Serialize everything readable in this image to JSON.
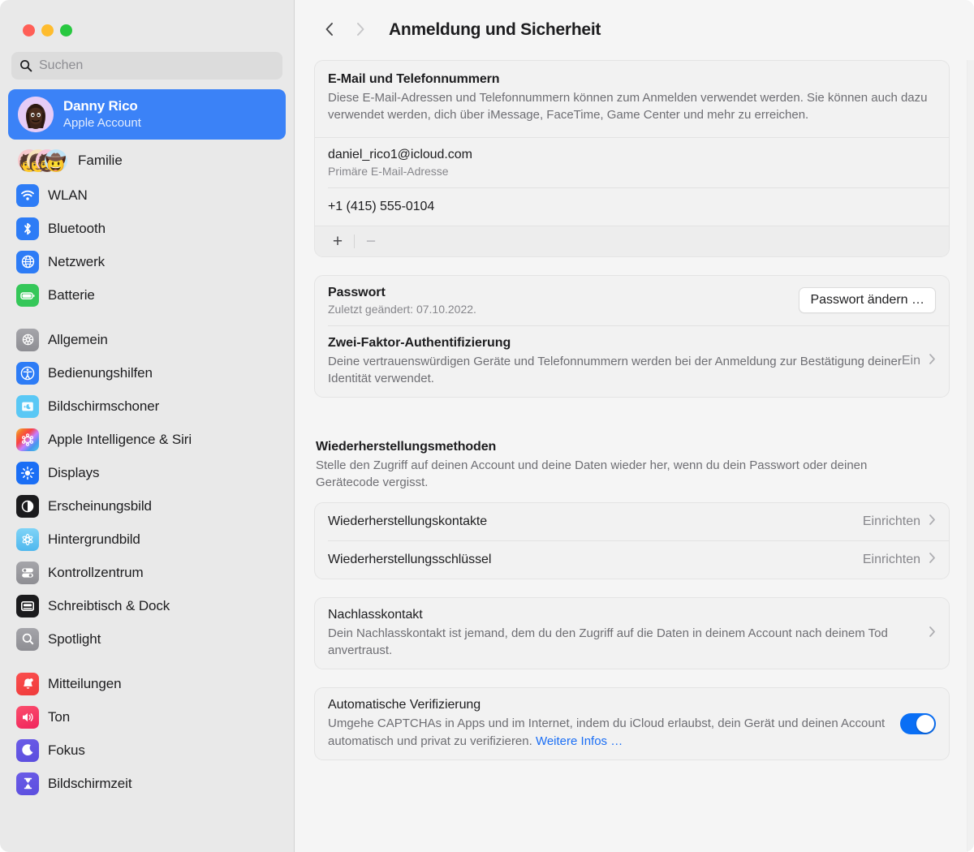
{
  "window": {
    "traffic_lights": [
      "close",
      "minimize",
      "zoom"
    ]
  },
  "sidebar": {
    "search": {
      "placeholder": "Suchen",
      "value": "",
      "icon": "search-icon"
    },
    "account": {
      "name": "Danny Rico",
      "subtitle": "Apple Account",
      "selected": true
    },
    "family": {
      "label": "Familie",
      "avatar_count": 4
    },
    "groups": [
      {
        "items": [
          {
            "label": "WLAN",
            "icon": "wifi-icon"
          },
          {
            "label": "Bluetooth",
            "icon": "bluetooth-icon"
          },
          {
            "label": "Netzwerk",
            "icon": "globe-icon"
          },
          {
            "label": "Batterie",
            "icon": "battery-icon"
          }
        ]
      },
      {
        "items": [
          {
            "label": "Allgemein",
            "icon": "gear-icon"
          },
          {
            "label": "Bedienungshilfen",
            "icon": "accessibility-icon"
          },
          {
            "label": "Bildschirmschoner",
            "icon": "screensaver-icon"
          },
          {
            "label": "Apple Intelligence & Siri",
            "icon": "apple-intelligence-icon"
          },
          {
            "label": "Displays",
            "icon": "display-brightness-icon"
          },
          {
            "label": "Erscheinungsbild",
            "icon": "appearance-icon"
          },
          {
            "label": "Hintergrundbild",
            "icon": "wallpaper-icon"
          },
          {
            "label": "Kontrollzentrum",
            "icon": "control-center-icon"
          },
          {
            "label": "Schreibtisch & Dock",
            "icon": "desktop-dock-icon"
          },
          {
            "label": "Spotlight",
            "icon": "spotlight-icon"
          }
        ]
      },
      {
        "items": [
          {
            "label": "Mitteilungen",
            "icon": "notifications-bell-icon"
          },
          {
            "label": "Ton",
            "icon": "sound-speaker-icon"
          },
          {
            "label": "Fokus",
            "icon": "focus-moon-icon"
          },
          {
            "label": "Bildschirmzeit",
            "icon": "screen-time-hourglass-icon"
          }
        ]
      }
    ]
  },
  "toolbar": {
    "back_icon": "chevron-left-icon",
    "forward_icon": "chevron-right-icon",
    "back_enabled": true,
    "forward_enabled": false,
    "title": "Anmeldung und Sicherheit"
  },
  "main": {
    "email_section": {
      "title": "E-Mail und Telefonnummern",
      "description": "Diese E-Mail-Adressen und Telefonnummern können zum Anmelden verwendet werden. Sie können auch dazu verwendet werden, dich über iMessage, FaceTime, Game Center und mehr zu erreichen.",
      "entries": [
        {
          "value": "daniel_rico1@icloud.com",
          "sub": "Primäre E-Mail-Adresse"
        },
        {
          "value": "+1 (415) 555-0104",
          "sub": ""
        }
      ],
      "add_label": "+",
      "remove_label": "−"
    },
    "password_section": {
      "title": "Passwort",
      "sub": "Zuletzt geändert: 07.10.2022.",
      "change_button": "Passwort ändern …",
      "two_factor": {
        "title": "Zwei-Faktor-Authentifizierung",
        "description": "Deine vertrauenswürdigen Geräte und Telefonnummern werden bei der Anmeldung zur Bestätigung deiner Identität verwendet.",
        "status": "Ein"
      }
    },
    "recovery_section": {
      "title": "Wiederherstellungsmethoden",
      "description": "Stelle den Zugriff auf deinen Account und deine Daten wieder her, wenn du dein Passwort oder deinen Gerätecode vergisst.",
      "rows": [
        {
          "title": "Wiederherstellungskontakte",
          "action": "Einrichten"
        },
        {
          "title": "Wiederherstellungsschlüssel",
          "action": "Einrichten"
        }
      ]
    },
    "legacy_section": {
      "title": "Nachlasskontakt",
      "description": "Dein Nachlasskontakt ist jemand, dem du den Zugriff auf die Daten in deinem Account nach deinem Tod anvertraust."
    },
    "auto_verify_section": {
      "title": "Automatische Verifizierung",
      "description_part1": "Umgehe CAPTCHAs in Apps und im Internet, indem du iCloud erlaubst, dein Gerät und deinen Account automatisch und privat zu verifizieren. ",
      "link_label": "Weitere Infos …",
      "enabled": true
    }
  },
  "colors": {
    "accent": "#0a6ff5",
    "selection": "#3b82f7",
    "sidebar_bg": "#e9e9e9",
    "content_bg": "#f5f5f5",
    "card_bg": "#f2f2f2",
    "link": "#1a6ef5"
  }
}
